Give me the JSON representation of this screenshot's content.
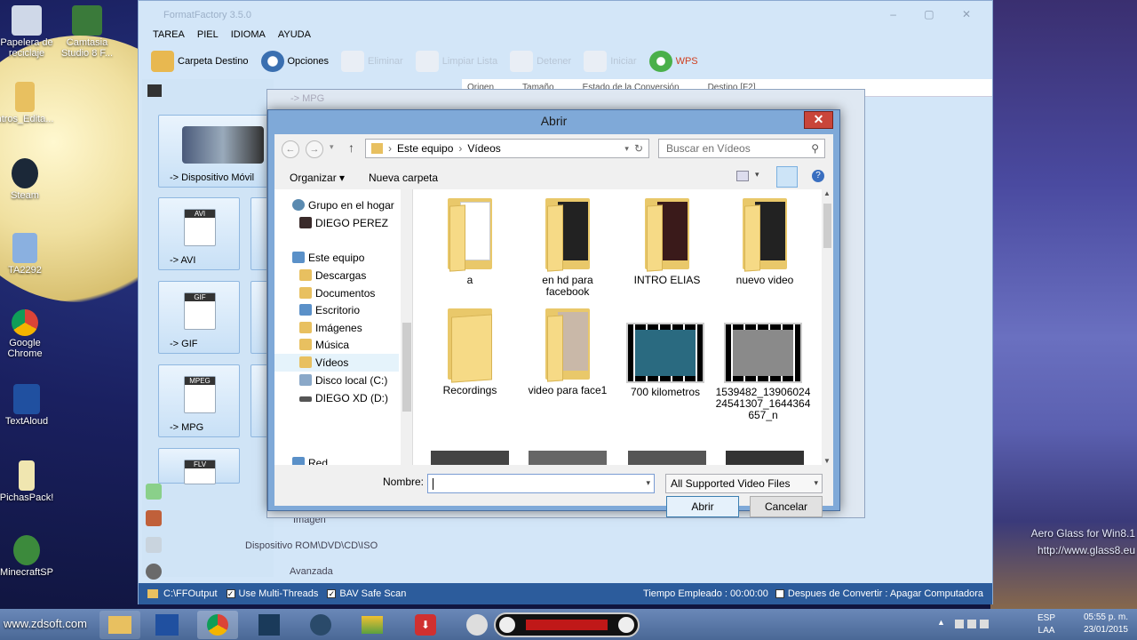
{
  "desktop": {
    "icons": [
      {
        "label": "Papelera de reciclaje"
      },
      {
        "label": "Camtasia Studio 8 F..."
      },
      {
        "label": "ntros_Edita..."
      },
      {
        "label": "Steam"
      },
      {
        "label": "TA2292"
      },
      {
        "label": "Google Chrome"
      },
      {
        "label": "TextAloud"
      },
      {
        "label": "PichasPack!"
      },
      {
        "label": "MinecraftSP"
      }
    ],
    "watermark_left": "www.zdsoft.com",
    "watermark_right_1": "Aero Glass for Win8.1",
    "watermark_right_2": "http://www.glass8.eu"
  },
  "formatfactory": {
    "title": "FormatFactory 3.5.0",
    "menu": [
      "TAREA",
      "PIEL",
      "IDIOMA",
      "AYUDA"
    ],
    "toolbar": {
      "dest": "Carpeta Destino",
      "options": "Opciones",
      "remove": "Eliminar",
      "clear": "Limpiar Lista",
      "stop": "Detener",
      "start": "Iniciar",
      "wps": "WPS"
    },
    "list_headers": [
      "Origen",
      "Tamaño",
      "Estado de la Conversión",
      "Destino [F2]"
    ],
    "tiles": {
      "mobile": "-> Dispositivo Móvil",
      "avi": "-> AVI",
      "gif": "-> GIF",
      "mpg": "-> MPG"
    },
    "tile_badges": {
      "avi": "AVI",
      "gif": "GIF",
      "mpeg": "MPEG",
      "flv": "FLV"
    },
    "sections": {
      "image": "Imagen",
      "rom": "Dispositivo ROM\\DVD\\CD\\ISO",
      "advanced": "Avanzada"
    },
    "status": {
      "output": "C:\\FFOutput",
      "multithreads": "Use Multi-Threads",
      "bav": "BAV Safe Scan",
      "time": "Tiempo Empleado : 00:00:00",
      "after": "Despues de Convertir : Apagar Computadora"
    }
  },
  "mpg_dialog": {
    "title": "-> MPG"
  },
  "open_dialog": {
    "title": "Abrir",
    "address": [
      "Este equipo",
      "Vídeos"
    ],
    "search_placeholder": "Buscar en Vídeos",
    "organize": "Organizar",
    "new_folder": "Nueva carpeta",
    "tree": [
      {
        "label": "Grupo en el hogar"
      },
      {
        "label": "DIEGO PEREZ"
      },
      {
        "label": "Este equipo"
      },
      {
        "label": "Descargas"
      },
      {
        "label": "Documentos"
      },
      {
        "label": "Escritorio"
      },
      {
        "label": "Imágenes"
      },
      {
        "label": "Música"
      },
      {
        "label": "Vídeos"
      },
      {
        "label": "Disco local (C:)"
      },
      {
        "label": "DIEGO XD (D:)"
      },
      {
        "label": "Red"
      }
    ],
    "files": [
      {
        "name": "a"
      },
      {
        "name": "en hd para facebook"
      },
      {
        "name": "INTRO ELIAS"
      },
      {
        "name": "nuevo video"
      },
      {
        "name": "Recordings"
      },
      {
        "name": "video para face1"
      },
      {
        "name": "700 kilometros"
      },
      {
        "name": "1539482_1390602424541307_1644364657_n"
      }
    ],
    "filename_label": "Nombre:",
    "filename_value": "",
    "filter": "All Supported Video Files",
    "open_btn": "Abrir",
    "cancel_btn": "Cancelar"
  },
  "taskbar": {
    "lang1": "ESP",
    "lang2": "LAA",
    "time": "05:55 p. m.",
    "date": "23/01/2015"
  }
}
